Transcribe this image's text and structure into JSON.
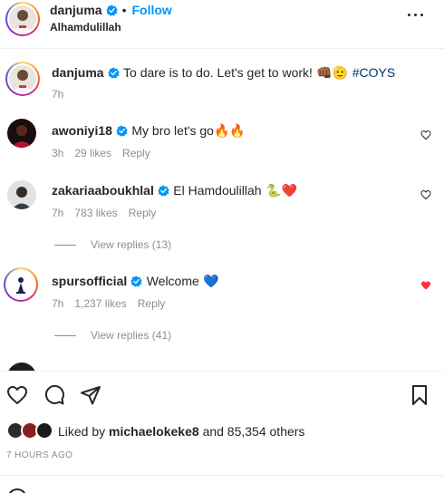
{
  "header": {
    "username": "danjuma",
    "follow_label": "Follow",
    "separator": "•",
    "subtitle": "Alhamdulillah"
  },
  "caption": {
    "username": "danjuma",
    "text": "To dare is to do. Let's get to work!",
    "emojis": "👊🏾🫡",
    "hashtag": "#COYS",
    "time": "7h"
  },
  "comments": [
    {
      "username": "awoniyi18",
      "text": "My bro let's go",
      "emojis": "🔥🔥",
      "time": "3h",
      "likes": "29 likes",
      "reply_label": "Reply",
      "liked": false
    },
    {
      "username": "zakariaaboukhlal",
      "text": "El Hamdoulillah",
      "emojis": "🐍❤️",
      "time": "7h",
      "likes": "783 likes",
      "reply_label": "Reply",
      "view_replies": "View replies (13)",
      "liked": false
    },
    {
      "username": "spursofficial",
      "text": "Welcome",
      "emojis": "💙",
      "time": "7h",
      "likes": "1,237 likes",
      "reply_label": "Reply",
      "view_replies": "View replies (41)",
      "liked": true
    }
  ],
  "footer": {
    "liked_by_prefix": "Liked by",
    "liked_by_user": "michaelokeke8",
    "liked_by_suffix": "and 85,354 others",
    "time_ago": "7 HOURS AGO"
  },
  "icons": {
    "like": "heart-outline-icon",
    "comment": "comment-bubble-icon",
    "share": "paper-plane-icon",
    "save": "bookmark-icon",
    "more": "more-horizontal-icon",
    "verified": "verified-badge-icon"
  },
  "colors": {
    "link_blue": "#0095f6",
    "verified_blue": "#0095f6",
    "liked_red": "#ff3040",
    "hashtag": "#00376b",
    "muted": "#8e8e8e"
  }
}
